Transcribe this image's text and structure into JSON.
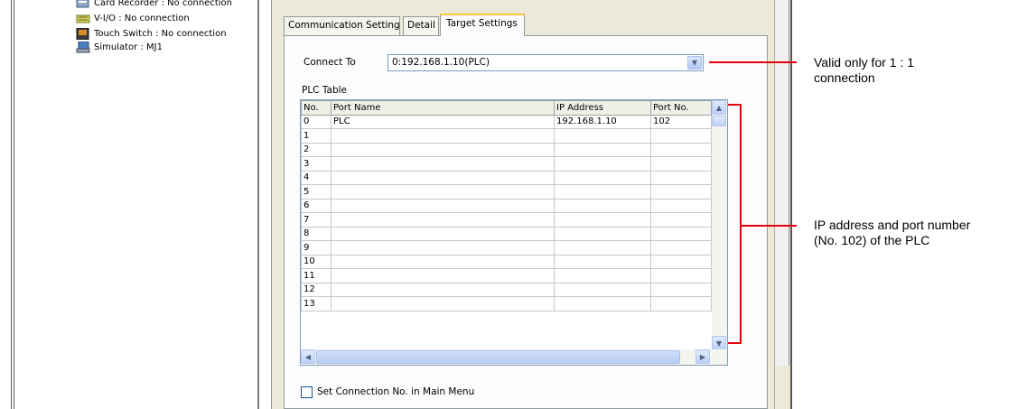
{
  "tree": {
    "items": [
      {
        "label": "Card Recorder : No connection",
        "icon": "card-recorder-icon"
      },
      {
        "label": "V-I/O : No connection",
        "icon": "vio-icon"
      },
      {
        "label": "Touch Switch : No connection",
        "icon": "touch-switch-icon"
      },
      {
        "label": "Simulator : MJ1",
        "icon": "simulator-icon"
      }
    ]
  },
  "tabs": [
    {
      "label": "Communication Setting"
    },
    {
      "label": "Detail"
    },
    {
      "label": "Target Settings",
      "active": true
    }
  ],
  "connect_to": {
    "label": "Connect To",
    "value": "0:192.168.1.10(PLC)"
  },
  "plc_table": {
    "title": "PLC Table",
    "columns": [
      "No.",
      "Port Name",
      "IP Address",
      "Port No."
    ],
    "rows": [
      [
        "0",
        "PLC",
        "192.168.1.10",
        "102"
      ],
      [
        "1",
        "",
        "",
        ""
      ],
      [
        "2",
        "",
        "",
        ""
      ],
      [
        "3",
        "",
        "",
        ""
      ],
      [
        "4",
        "",
        "",
        ""
      ],
      [
        "5",
        "",
        "",
        ""
      ],
      [
        "6",
        "",
        "",
        ""
      ],
      [
        "7",
        "",
        "",
        ""
      ],
      [
        "8",
        "",
        "",
        ""
      ],
      [
        "9",
        "",
        "",
        ""
      ],
      [
        "10",
        "",
        "",
        ""
      ],
      [
        "11",
        "",
        "",
        ""
      ],
      [
        "12",
        "",
        "",
        ""
      ],
      [
        "13",
        "",
        "",
        ""
      ]
    ]
  },
  "checkbox": {
    "label": "Set Connection No. in Main Menu",
    "checked": false
  },
  "annotations": {
    "connect_note_line1": "Valid only for 1 : 1",
    "connect_note_line2": "connection",
    "table_note_line1": "IP address and port number",
    "table_note_line2": "(No. 102) of the PLC"
  },
  "colors": {
    "annotation_line": "#e3000f",
    "dialog_bg": "#ece9d8",
    "tab_highlight": "#ffc83c"
  }
}
